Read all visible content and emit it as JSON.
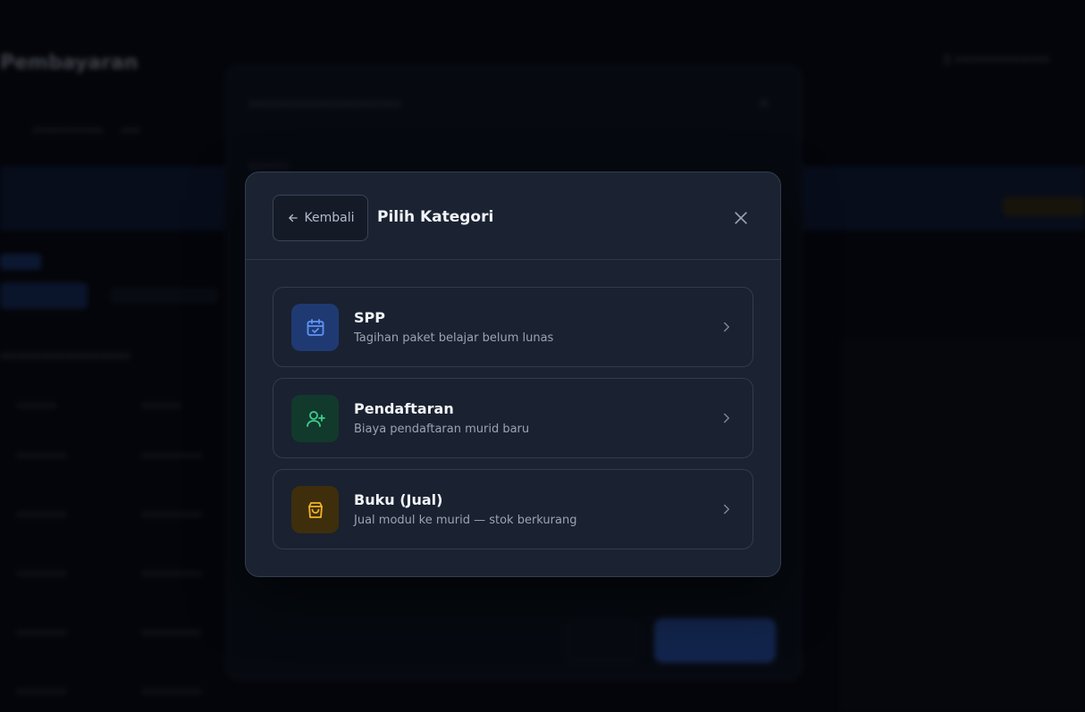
{
  "background": {
    "page_title": "Pembayaran",
    "blurred": true
  },
  "dialog": {
    "back_label": "Kembali",
    "title": "Pilih Kategori",
    "options": [
      {
        "title": "SPP",
        "subtitle": "Tagihan paket belajar belum lunas",
        "icon": "calendar-check-icon",
        "icon_bg": "#1f3a73",
        "icon_color": "#5f95f5"
      },
      {
        "title": "Pendaftaran",
        "subtitle": "Biaya pendaftaran murid baru",
        "icon": "user-plus-icon",
        "icon_bg": "#123a2c",
        "icon_color": "#3ecf8e"
      },
      {
        "title": "Buku (Jual)",
        "subtitle": "Jual modul ke murid — stok berkurang",
        "icon": "shopping-bag-icon",
        "icon_bg": "#3e2e0c",
        "icon_color": "#f0b429"
      }
    ]
  },
  "colors": {
    "dialog_bg": "#1b2332",
    "card_bg": "#1a2130",
    "border": "#323c4e",
    "text_primary": "#f1f4f9",
    "text_secondary": "#9ba4b4"
  }
}
